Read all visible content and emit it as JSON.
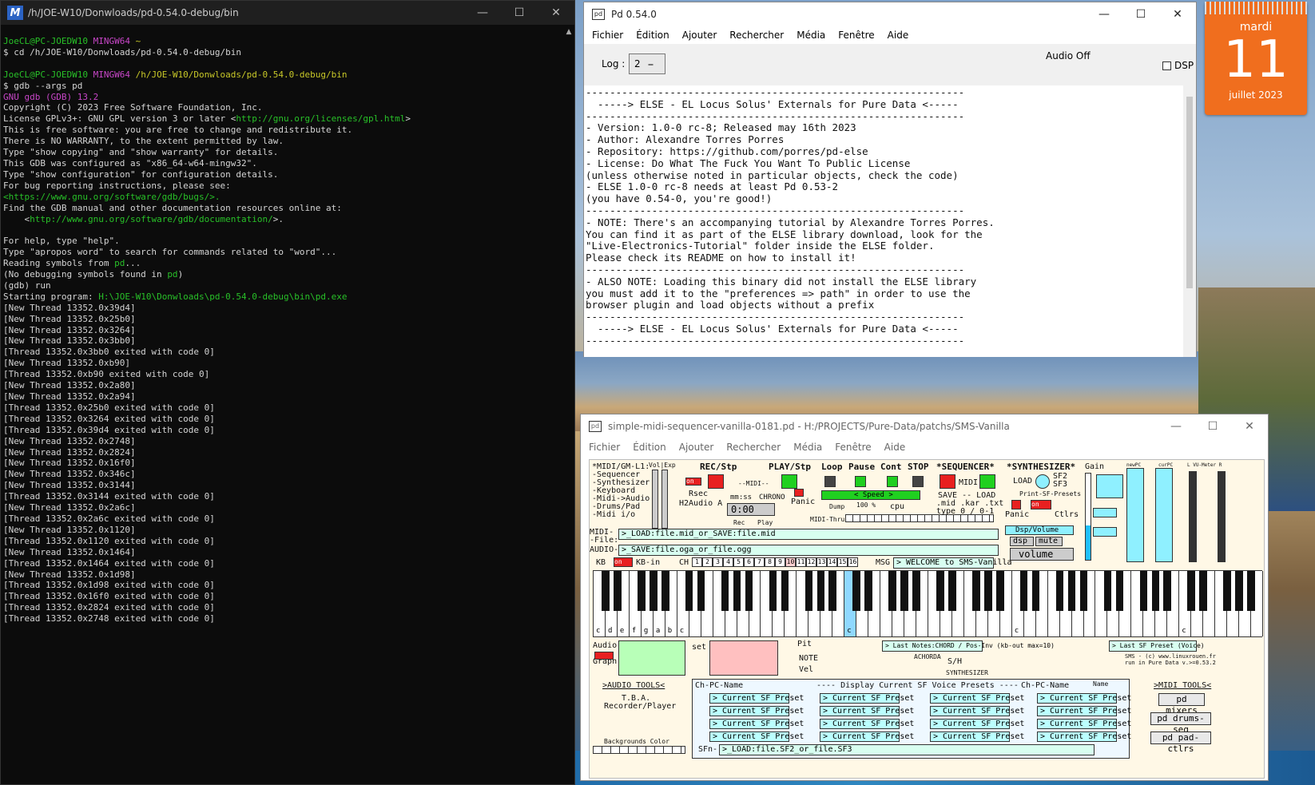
{
  "terminal": {
    "title": "/h/JOE-W10/Donwloads/pd-0.54.0-debug/bin",
    "prompt_user": "JoeCL@PC-JOEDW10",
    "prompt_shell": "MINGW64",
    "prompt1_path": "~",
    "cmd1": "$ cd /h/JOE-W10/Donwloads/pd-0.54.0-debug/bin",
    "prompt2_path": "/h/JOE-W10/Donwloads/pd-0.54.0-debug/bin",
    "cmd2": "$ gdb --args pd",
    "gdb_version": "GNU gdb (GDB) 13.2",
    "copyright": "Copyright (C) 2023 Free Software Foundation, Inc.",
    "license_pre": "License GPLv3+: GNU GPL version 3 or later <",
    "license_url": "http://gnu.org/licenses/gpl.html",
    "license_post": ">",
    "line_free": "This is free software: you are free to change and redistribute it.",
    "line_warranty": "There is NO WARRANTY, to the extent permitted by law.",
    "line_type_copying": "Type \"show copying\" and \"show warranty\" for details.",
    "line_configured": "This GDB was configured as \"x86_64-w64-mingw32\".",
    "line_type_config": "Type \"show configuration\" for configuration details.",
    "line_bug": "For bug reporting instructions, please see:",
    "bug_url": "<https://www.gnu.org/software/gdb/bugs/>.",
    "line_find": "Find the GDB manual and other documentation resources online at:",
    "doc_url_pre": "    <",
    "doc_url": "http://www.gnu.org/software/gdb/documentation/",
    "doc_url_post": ">.",
    "line_help": "For help, type \"help\".",
    "line_apropos": "Type \"apropos word\" to search for commands related to \"word\"...",
    "line_reading_pre": "Reading symbols from ",
    "pd_word": "pd",
    "line_reading_post": "...",
    "line_nodebug_pre": "(No debugging symbols found in ",
    "line_nodebug_post": ")",
    "line_run": "(gdb) run",
    "line_start_pre": "Starting program: ",
    "start_path": "H:\\JOE-W10\\Donwloads\\pd-0.54.0-debug\\bin\\pd.exe",
    "threads": [
      "[New Thread 13352.0x39d4]",
      "[New Thread 13352.0x25b0]",
      "[New Thread 13352.0x3264]",
      "[New Thread 13352.0x3bb0]",
      "[Thread 13352.0x3bb0 exited with code 0]",
      "[New Thread 13352.0xb90]",
      "[Thread 13352.0xb90 exited with code 0]",
      "[New Thread 13352.0x2a80]",
      "[New Thread 13352.0x2a94]",
      "[Thread 13352.0x25b0 exited with code 0]",
      "[Thread 13352.0x3264 exited with code 0]",
      "[Thread 13352.0x39d4 exited with code 0]",
      "[New Thread 13352.0x2748]",
      "[New Thread 13352.0x2824]",
      "[New Thread 13352.0x16f0]",
      "[New Thread 13352.0x346c]",
      "[New Thread 13352.0x3144]",
      "[Thread 13352.0x3144 exited with code 0]",
      "[New Thread 13352.0x2a6c]",
      "[Thread 13352.0x2a6c exited with code 0]",
      "[New Thread 13352.0x1120]",
      "[Thread 13352.0x1120 exited with code 0]",
      "[New Thread 13352.0x1464]",
      "[Thread 13352.0x1464 exited with code 0]",
      "[New Thread 13352.0x1d98]",
      "[Thread 13352.0x1d98 exited with code 0]",
      "[Thread 13352.0x16f0 exited with code 0]",
      "[Thread 13352.0x2824 exited with code 0]",
      "[Thread 13352.0x2748 exited with code 0]"
    ]
  },
  "pd_main": {
    "title": "Pd 0.54.0",
    "menu": [
      "Fichier",
      "Édition",
      "Ajouter",
      "Rechercher",
      "Média",
      "Fenêtre",
      "Aide"
    ],
    "log_label": "Log :",
    "log_value": "2",
    "audio_status": "Audio Off",
    "dsp_label": "DSP",
    "console": [
      "---------------------------------------------------------------",
      "  -----> ELSE - EL Locus Solus' Externals for Pure Data <-----",
      "---------------------------------------------------------------",
      "- Version: 1.0-0 rc-8; Released may 16th 2023",
      "- Author: Alexandre Torres Porres",
      "- Repository: https://github.com/porres/pd-else",
      "- License: Do What The Fuck You Want To Public License",
      "(unless otherwise noted in particular objects, check the code)",
      "- ELSE 1.0-0 rc-8 needs at least Pd 0.53-2",
      "(you have 0.54-0, you're good!)",
      "---------------------------------------------------------------",
      "- NOTE: There's an accompanying tutorial by Alexandre Torres Porres.",
      "You can find it as part of the ELSE library download, look for the",
      "\"Live-Electronics-Tutorial\" folder inside the ELSE folder.",
      "Please check its README on how to install it!",
      "---------------------------------------------------------------",
      "- ALSO NOTE: Loading this binary did not install the ELSE library",
      "you must add it to the \"preferences => path\" in order to use the",
      "browser plugin and load objects without a prefix",
      "---------------------------------------------------------------",
      "  -----> ELSE - EL Locus Solus' Externals for Pure Data <-----",
      "---------------------------------------------------------------"
    ]
  },
  "calendar": {
    "day_name": "mardi",
    "day_num": "11",
    "month_year": "juillet 2023"
  },
  "sms": {
    "title": "simple-midi-sequencer-vanilla-0181.pd  - H:/PROJECTS/Pure-Data/patchs/SMS-Vanilla",
    "menu": [
      "Fichier",
      "Édition",
      "Ajouter",
      "Rechercher",
      "Média",
      "Fenêtre",
      "Aide"
    ],
    "left_menu": "*MIDI/GM-L1:\n-Sequencer\n-Synthesizer\n-Keyboard\n-Midi->Audio\n-Drums/Pad\n-Midi i/o",
    "volexp": "Vol|Exp",
    "rec_stp": "REC/Stp",
    "play_stp": "PLAY/Stp",
    "loop": "Loop",
    "pause": "Pause",
    "cont": "Cont",
    "stop": "STOP",
    "sequencer": "*SEQUENCER*",
    "synthesizer": "*SYNTHESIZER*",
    "gain": "Gain",
    "newpc": "newPC",
    "curpc": "curPC",
    "vumeter": "L VU-Meter R",
    "rsec": "Rsec",
    "h2audio": "H2Audio A",
    "midi_lbl": "--MIDI--",
    "mmss": "mm:ss",
    "chrono": "CHRONO",
    "time": "0:00",
    "rec_lbl": "Rec",
    "play_lbl": "Play",
    "panic": "Panic",
    "speed": "< Speed >",
    "speed_pct": "100 %",
    "cpu": "cpu",
    "dump": "Dump",
    "midi_thru": "MIDI-Thru",
    "save_lbl": "SAVE -- LOAD",
    "file_types": ".mid .kar .txt",
    "type_lbl": "type 0 / 0-1",
    "midi_lbl2": "MIDI",
    "load_lbl": "LOAD",
    "sf2": "SF2",
    "sf3": "SF3",
    "print_sf": "Print-SF-Presets",
    "panic2": "Panic",
    "ctlrs": "Ctlrs",
    "on": "on",
    "dsp_volume": "Dsp/Volume",
    "dsp": "dsp",
    "mute": "mute",
    "volume": "volume",
    "midi_file": "MIDI-\n-File:",
    "audio_lbl": "AUDIO-",
    "load_file": ">_LOAD:file.mid_or_SAVE:file.mid",
    "save_file": ">_SAVE:file.oga_or_file.ogg",
    "kb": "KB",
    "kbin": "KB-in",
    "ch": "CH",
    "channels": [
      "1",
      "2",
      "3",
      "4",
      "5",
      "6",
      "7",
      "8",
      "9",
      "10",
      "11",
      "12",
      "13",
      "14",
      "15",
      "16"
    ],
    "msg": "MSG",
    "welcome": "> WELCOME to SMS-Vanilla",
    "key_labels": [
      "c",
      "d",
      "e",
      "f",
      "g",
      "a",
      "b",
      "c",
      "c",
      "c",
      "c",
      "c"
    ],
    "audio_graph": "Audio\n\nGraph",
    "set": "set",
    "pit": "Pit",
    "note": "NOTE",
    "vel": "Vel",
    "last_notes": "> Last Notes:CHORD / Pos-Inv (kb-out max=10)",
    "achorda": "ACHORDA",
    "sh": "S/H",
    "synth2": "SYNTHESIZER",
    "last_sf": "> Last SF Preset (Voice)",
    "credits": "SMS - (c) www.linuxrouen.fr\nrun in Pure Data v.>=0.53.2",
    "audio_tools": ">AUDIO TOOLS<",
    "tba": "T.B.A.",
    "recorder": "Recorder/Player",
    "bg_color": "Backgrounds Color",
    "chpc_name": "Ch-PC-Name",
    "display_current": "---- Display Current SF Voice Presets ----",
    "name": "Name",
    "preset_label": "> Current SF Preset",
    "sfn": "SFn-",
    "sf_file": ">_LOAD:file.SF2_or_file.SF3",
    "midi_tools": ">MIDI TOOLS<",
    "pd_mixers": "pd mixers",
    "pd_drums": "pd drums-seq",
    "pd_pad": "pd pad-ctlrs"
  },
  "colors": {
    "terminal_bg": "#0c0c0c",
    "calendar": "#f06e1e",
    "sms_canvas": "#fff8e6"
  }
}
